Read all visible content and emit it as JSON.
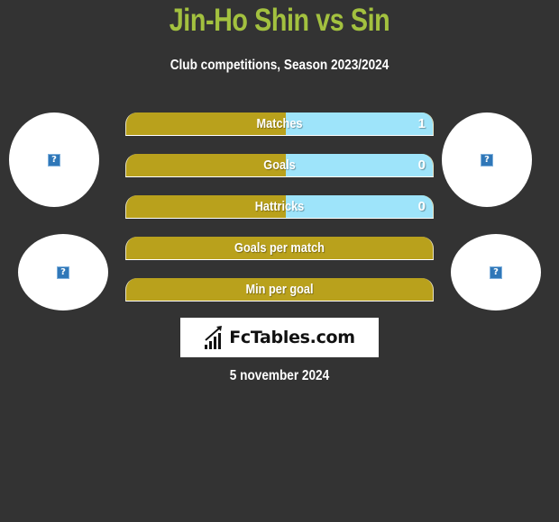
{
  "header": {
    "title": "Jin-Ho Shin vs Sin",
    "subtitle": "Club competitions, Season 2023/2024"
  },
  "players": {
    "left": {
      "avatar_icon": "broken-image-icon",
      "avatar_glyph": "?"
    },
    "right": {
      "avatar_icon": "broken-image-icon",
      "avatar_glyph": "?"
    }
  },
  "stats": [
    {
      "label": "Matches",
      "left_value": "",
      "right_value": "1",
      "right_share_percent": 48
    },
    {
      "label": "Goals",
      "left_value": "",
      "right_value": "0",
      "right_share_percent": 48
    },
    {
      "label": "Hattricks",
      "left_value": "",
      "right_value": "0",
      "right_share_percent": 48
    },
    {
      "label": "Goals per match",
      "left_value": "",
      "right_value": "",
      "right_share_percent": 0
    },
    {
      "label": "Min per goal",
      "left_value": "",
      "right_value": "",
      "right_share_percent": 0
    }
  ],
  "logo": {
    "text": "FcTables.com",
    "icon": "bar-chart-icon"
  },
  "footer": {
    "date": "5 november 2024"
  },
  "colors": {
    "background": "#333333",
    "title": "#a3c13f",
    "left_bar": "#b9a11c",
    "right_bar": "#9ee4fa"
  }
}
